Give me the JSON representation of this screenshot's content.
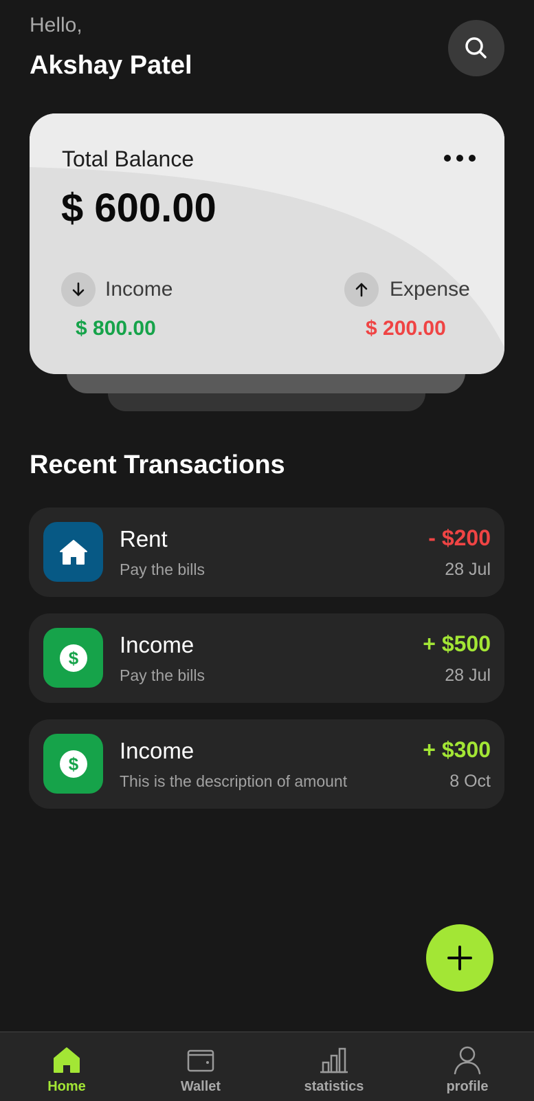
{
  "header": {
    "greeting": "Hello,",
    "user_name": "Akshay Patel",
    "search_icon": "search-icon"
  },
  "balance_card": {
    "title": "Total Balance",
    "amount": "$ 600.00",
    "menu_icon": "more-horizontal-icon",
    "income": {
      "label": "Income",
      "amount": "$ 800.00",
      "icon": "arrow-down-icon"
    },
    "expense": {
      "label": "Expense",
      "amount": "$ 200.00",
      "icon": "arrow-up-icon"
    }
  },
  "transactions": {
    "title": "Recent Transactions",
    "items": [
      {
        "name": "Rent",
        "description": "Pay the bills",
        "amount": "- $200",
        "date": "28 Jul",
        "icon": "home-icon",
        "type": "expense"
      },
      {
        "name": "Income",
        "description": "Pay the bills",
        "amount": "+ $500",
        "date": "28 Jul",
        "icon": "dollar-icon",
        "type": "income"
      },
      {
        "name": "Income",
        "description": "This is the description of amount",
        "amount": "+ $300",
        "date": "8 Oct",
        "icon": "dollar-icon",
        "type": "income"
      }
    ]
  },
  "fab": {
    "icon": "plus-icon"
  },
  "bottom_nav": {
    "items": [
      {
        "label": "Home",
        "icon": "home-icon",
        "active": true
      },
      {
        "label": "Wallet",
        "icon": "wallet-icon",
        "active": false
      },
      {
        "label": "statistics",
        "icon": "bar-chart-icon",
        "active": false
      },
      {
        "label": "profile",
        "icon": "user-icon",
        "active": false
      }
    ]
  },
  "colors": {
    "background": "#181818",
    "surface": "#262626",
    "card": "#dddddd",
    "accent": "#a3e635",
    "income_green": "#16a34a",
    "expense_red": "#ef4444",
    "rent_icon_bg": "#075985",
    "income_icon_bg": "#16a34a"
  }
}
